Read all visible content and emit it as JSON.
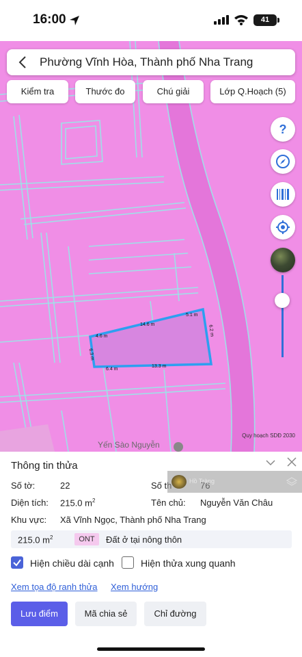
{
  "status_bar": {
    "time": "16:00",
    "battery": "41"
  },
  "header": {
    "title": "Phường Vĩnh Hòa, Thành phố Nha Trang"
  },
  "toolbar": {
    "buttons": [
      "Kiểm tra",
      "Thước đo",
      "Chú giải",
      "Lớp Q.Hoạch (5)"
    ]
  },
  "map": {
    "edge_labels": [
      "5.1 m",
      "14.6 m",
      "4.6 m",
      "6.3 m",
      "6.4 m",
      "13.3 m",
      "6.2 m"
    ],
    "footnote": "Quy hoạch SDĐ 2030",
    "place_label": "Yến Sào Nguyễn",
    "controls": [
      "help-icon",
      "compass-icon",
      "barcode-icon",
      "locate-icon",
      "satellite-layer-icon"
    ],
    "colors": {
      "zoning": "#f08ee6",
      "parcel_outline": "#2d9ff0",
      "road_lines": "#9fe0e8"
    }
  },
  "panel": {
    "title": "Thông tin thửa",
    "so_to_label": "Số tờ:",
    "so_to_value": "22",
    "so_thua_label": "Số th",
    "so_thua_value": "76",
    "dien_tich_label": "Diện tích:",
    "dien_tich_value": "215.0 m",
    "dien_tich_sup": "2",
    "ten_chu_label": "Tên chủ:",
    "ten_chu_value": "Nguyễn Văn Châu",
    "khu_vuc_label": "Khu vực:",
    "khu_vuc_value": "Xã Vĩnh Ngọc, Thành phố Nha Trang",
    "land_use": {
      "area": "215.0 m",
      "area_sup": "2",
      "code": "ONT",
      "description": "Đất ở tại nông thôn"
    },
    "checkbox_edges": {
      "label": "Hiện chiều dài cạnh",
      "checked": true
    },
    "checkbox_neighbors": {
      "label": "Hiện thửa xung quanh",
      "checked": false
    },
    "link_coords": "Xem tọa độ ranh thửa",
    "link_direction": "Xem hướng",
    "btn_save": "Lưu điểm",
    "btn_share": "Mã chia sẻ",
    "btn_directions": "Chỉ đường",
    "video_overlay_title": "Hồ Tràng"
  }
}
